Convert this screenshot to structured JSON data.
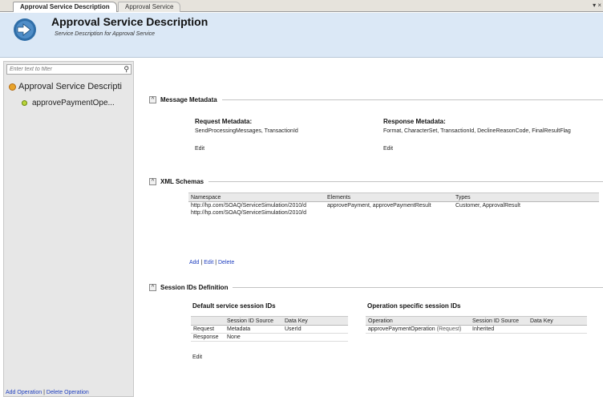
{
  "tabs": [
    {
      "label": "Approval Service Description"
    },
    {
      "label": "Approval Service"
    }
  ],
  "tab_menu": "▾ ×",
  "header": {
    "title": "Approval Service Description",
    "subtitle": "Service Description for Approval Service"
  },
  "left": {
    "filter_placeholder": "Enter text to filter",
    "tree_root": "Approval Service Descripti",
    "tree_child": "approvePaymentOpe...",
    "footer_add": "Add Operation",
    "footer_sep": "|",
    "footer_delete": "Delete Operation"
  },
  "message_metadata": {
    "title": "Message Metadata",
    "request_label": "Request Metadata:",
    "request_value": "SendProcessingMessages, TransactionId",
    "request_edit": "Edit",
    "response_label": "Response Metadata:",
    "response_value": "Format, CharacterSet, TransactionId, DeclineReasonCode, FinalResultFlag",
    "response_edit": "Edit"
  },
  "xml_schemas": {
    "title": "XML Schemas",
    "headers": [
      "Namespace",
      "Elements",
      "Types"
    ],
    "rows": [
      [
        "http://hp.com/SOAQ/ServiceSimulation/2010/d",
        "approvePayment, approvePaymentResult",
        "Customer, ApprovalResult"
      ],
      [
        "http://hp.com/SOAQ/ServiceSimulation/2010/d",
        "",
        ""
      ]
    ],
    "add": "Add",
    "edit": "Edit",
    "delete": "Delete",
    "sep": "|"
  },
  "session_ids": {
    "title": "Session IDs Definition",
    "default_label": "Default service session IDs",
    "default_headers": [
      "",
      "Session ID Source",
      "Data Key"
    ],
    "default_rows": [
      [
        "Request",
        "Metadata",
        "UserId"
      ],
      [
        "Response",
        "None",
        ""
      ]
    ],
    "default_edit": "Edit",
    "op_label": "Operation specific session IDs",
    "op_headers": [
      "Operation",
      "Session ID Source",
      "Data Key"
    ],
    "op_rows": [
      {
        "operation": "approvePaymentOperation",
        "qualifier": "(Request)",
        "source": "Inherited",
        "key": ""
      }
    ]
  }
}
